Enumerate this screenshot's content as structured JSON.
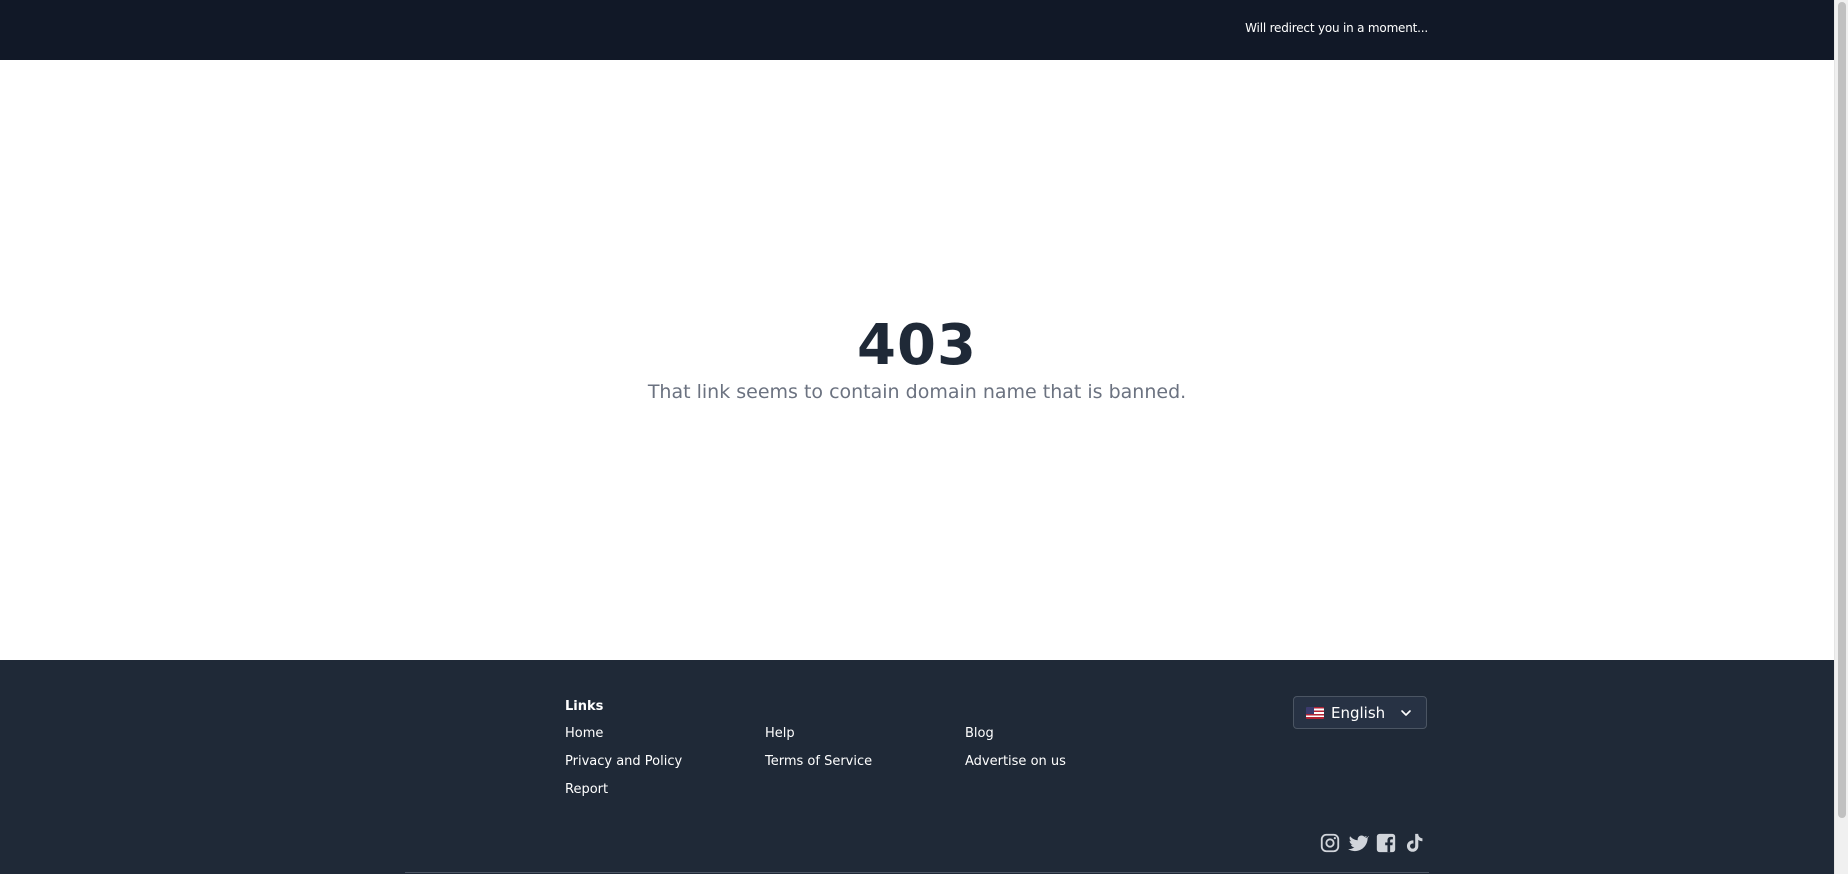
{
  "header": {
    "redirect_text": "Will redirect you in a moment..."
  },
  "error": {
    "code": "403",
    "message": "That link seems to contain domain name that is banned."
  },
  "footer": {
    "links_heading": "Links",
    "links": {
      "home": "Home",
      "help": "Help",
      "blog": "Blog",
      "privacy": "Privacy and Policy",
      "terms": "Terms of Service",
      "advertise": "Advertise on us",
      "report": "Report"
    },
    "language": {
      "selected": "English",
      "flag": "us-flag"
    },
    "socials": [
      "instagram-icon",
      "twitter-icon",
      "facebook-icon",
      "tiktok-icon"
    ]
  },
  "colors": {
    "topbar_bg": "#111827",
    "footer_bg": "#1f2937",
    "error_code": "#1f2937",
    "error_message": "#6b7280"
  }
}
